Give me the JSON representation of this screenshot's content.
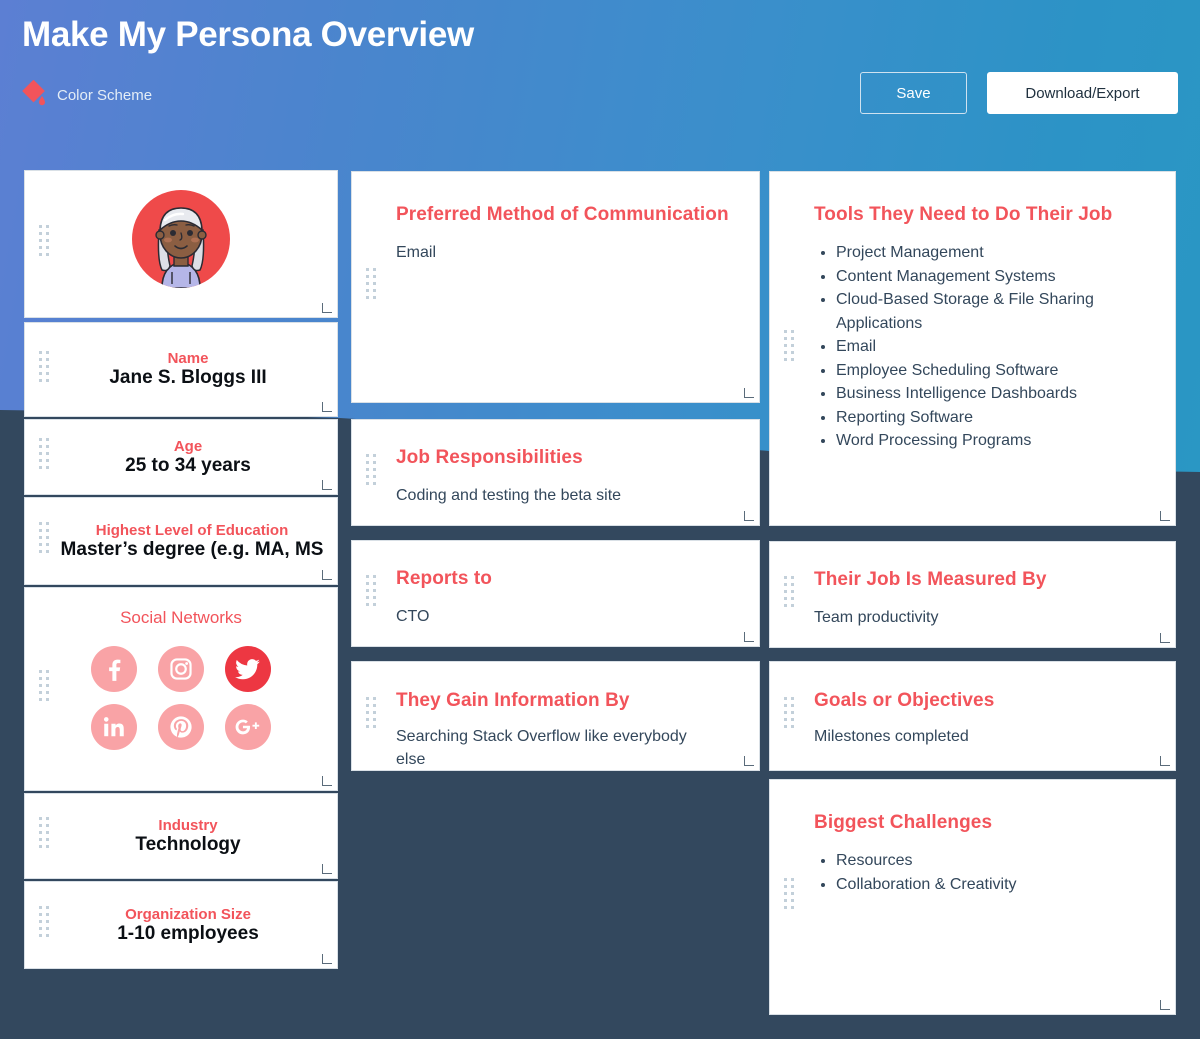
{
  "header": {
    "title": "Make My Persona Overview",
    "color_scheme_label": "Color Scheme",
    "color_scheme_icon": "ink-drop-icon",
    "save_label": "Save",
    "download_label": "Download/Export"
  },
  "colors": {
    "accent_red": "#f2545b",
    "text_dark": "#33475b",
    "board_bg": "#33485e",
    "header_gradient_start": "#5c7fd3",
    "header_gradient_end": "#2a97c4",
    "avatar_circle": "#ef4a4a",
    "social_inactive": "#f9a3a6",
    "social_active": "#ed3742"
  },
  "left_column": {
    "avatar": {
      "name": "persona-avatar",
      "circle_color": "#ef4a4a",
      "hair_color": "#dcdee6",
      "skin_color": "#8b5e42",
      "shirt_color": "#b5b6e8"
    },
    "fields": [
      {
        "label": "Name",
        "value": "Jane S. Bloggs III"
      },
      {
        "label": "Age",
        "value": "25 to 34 years"
      },
      {
        "label": "Highest Level of Education",
        "value": "Master’s degree (e.g. MA, MS"
      },
      {
        "label": "Industry",
        "value": "Technology"
      },
      {
        "label": "Organization Size",
        "value": "1-10 employees"
      }
    ],
    "social": {
      "title": "Social Networks",
      "items": [
        {
          "name": "facebook-icon",
          "label": "Facebook",
          "active": false
        },
        {
          "name": "instagram-icon",
          "label": "Instagram",
          "active": false
        },
        {
          "name": "twitter-icon",
          "label": "Twitter",
          "active": true
        },
        {
          "name": "linkedin-icon",
          "label": "LinkedIn",
          "active": false
        },
        {
          "name": "pinterest-icon",
          "label": "Pinterest",
          "active": false
        },
        {
          "name": "googleplus-icon",
          "label": "Google Plus",
          "active": false
        }
      ]
    }
  },
  "middle_column": [
    {
      "title": "Preferred Method of Communication",
      "text": "Email"
    },
    {
      "title": "Job Responsibilities",
      "text": "Coding and testing the beta site"
    },
    {
      "title": "Reports to",
      "text": "CTO"
    },
    {
      "title": "They Gain Information By",
      "text": "Searching Stack Overflow like everybody else"
    }
  ],
  "right_column": [
    {
      "title": "Tools They Need to Do Their Job",
      "list": [
        "Project Management",
        "Content Management Systems",
        "Cloud-Based Storage & File Sharing Applications",
        "Email",
        "Employee Scheduling Software",
        "Business Intelligence Dashboards",
        "Reporting Software",
        "Word Processing Programs"
      ]
    },
    {
      "title": "Their Job Is Measured By",
      "text": "Team productivity"
    },
    {
      "title": "Goals or Objectives",
      "text": "Milestones completed"
    },
    {
      "title": "Biggest Challenges",
      "list": [
        "Resources",
        "Collaboration & Creativity"
      ]
    }
  ]
}
